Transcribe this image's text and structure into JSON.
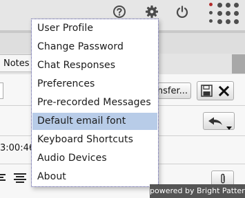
{
  "header": {
    "icons": [
      "help-icon",
      "settings-icon",
      "power-icon",
      "grip-dots-icon"
    ]
  },
  "tabs": {
    "notes_label": "Notes"
  },
  "toolbar": {
    "transfer_label": "nsfer..."
  },
  "chat": {
    "timestamp_partial": "3:00:46"
  },
  "user_menu": {
    "items": [
      {
        "label": "User Profile"
      },
      {
        "label": "Change Password"
      },
      {
        "label": "Chat Responses"
      },
      {
        "label": "Preferences"
      },
      {
        "label": "Pre-recorded Messages"
      },
      {
        "label": "Default email font",
        "highlighted": true
      },
      {
        "label": "Keyboard Shortcuts"
      },
      {
        "label": "Audio Devices"
      },
      {
        "label": "About"
      }
    ]
  },
  "footer": {
    "powered_by": "powered by Bright Pattern"
  },
  "colors": {
    "menu_highlight": "#b8cce8",
    "menu_border": "#3e3e8e",
    "footer_bg": "#555555",
    "icon_dark": "#4a4a4a"
  }
}
